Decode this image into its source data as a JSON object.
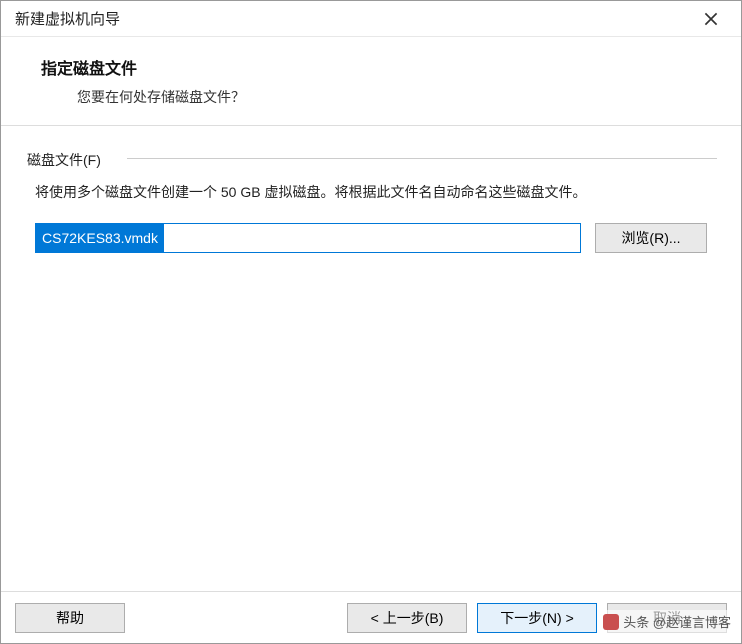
{
  "window": {
    "title": "新建虚拟机向导"
  },
  "header": {
    "heading": "指定磁盘文件",
    "subheading": "您要在何处存储磁盘文件？"
  },
  "group": {
    "legend": "磁盘文件(F)",
    "description": "将使用多个磁盘文件创建一个 50 GB 虚拟磁盘。将根据此文件名自动命名这些磁盘文件。",
    "filename": "CS72KES83.vmdk",
    "browse_label": "浏览(R)..."
  },
  "footer": {
    "help": "帮助",
    "back": "< 上一步(B)",
    "next": "下一步(N) >",
    "cancel": "取消"
  },
  "watermark": {
    "text": "头条 @赵谨言博客"
  }
}
